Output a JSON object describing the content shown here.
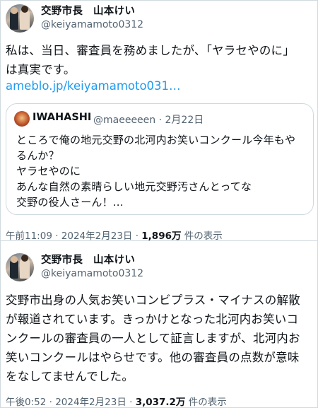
{
  "tweet1": {
    "name": "交野市長　山本けい",
    "handle": "@keiyamamoto0312",
    "text_lines": [
      "私は、当日、審査員を務めましたが、「ヤラセやのに」",
      "は真実です。"
    ],
    "link": "ameblo.jp/keiyamamoto031…",
    "quote": {
      "name": "IWAHASHI",
      "handle": "@maeeeeen · 2月22日",
      "lines": [
        "ところで俺の地元交野の北河内お笑いコンクール今年もや",
        "るんか？",
        "ヤラセやのに",
        "あんな自然の素晴らしい地元交野汚さんとってな",
        "交野の役人さーん！..."
      ]
    },
    "meta_time": "午前11:09 · 2024年2月23日 · ",
    "meta_views": "1,896万",
    "meta_suffix": " 件の表示"
  },
  "tweet2": {
    "name": "交野市長　山本けい",
    "handle": "@keiyamamoto0312",
    "text_lines": [
      "交野市出身の人気お笑いコンビプラス・マイナスの解散",
      "が報道されています。きっかけとなった北河内お笑いコ",
      "ンクールの審査員の一人として証言しますが、北河内お",
      "笑いコンクールはやらせです。他の審査員の点数が意味",
      "をなしてませんでした。"
    ],
    "meta_time": "午後0:52 · 2024年2月23日 · ",
    "meta_views": "3,037.2万",
    "meta_suffix": " 件の表示"
  },
  "colors": {
    "link": "#1d9bf0",
    "secondary_text": "#536471",
    "border": "#cfd9de"
  }
}
